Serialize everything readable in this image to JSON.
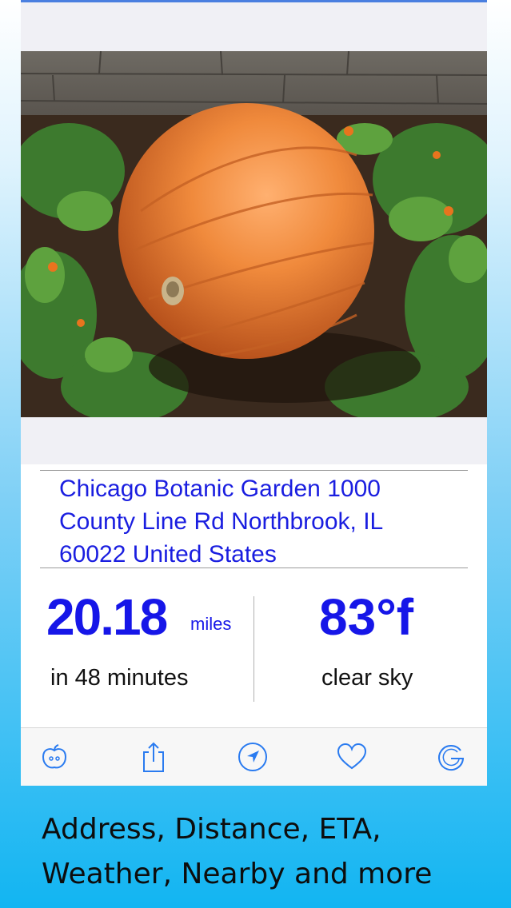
{
  "photo": {
    "subject": "pumpkin"
  },
  "place": {
    "address_lines": [
      "Chicago Botanic Garden 1000",
      "County Line Rd Northbrook, IL",
      "60022 United States"
    ]
  },
  "distance": {
    "value": "20.18",
    "unit": "miles",
    "eta": "in 48 minutes"
  },
  "weather": {
    "temperature": "83°f",
    "condition": "clear sky"
  },
  "toolbar": {
    "icons": [
      "apple-icon",
      "share-icon",
      "navigate-icon",
      "heart-icon",
      "google-icon"
    ],
    "accent_color": "#2a7bf0"
  },
  "tagline": {
    "line1": "Address, Distance, ETA,",
    "line2": "Weather, Nearby and more"
  },
  "colors": {
    "text_accent": "#1616e8",
    "address": "#1a1ee0"
  }
}
